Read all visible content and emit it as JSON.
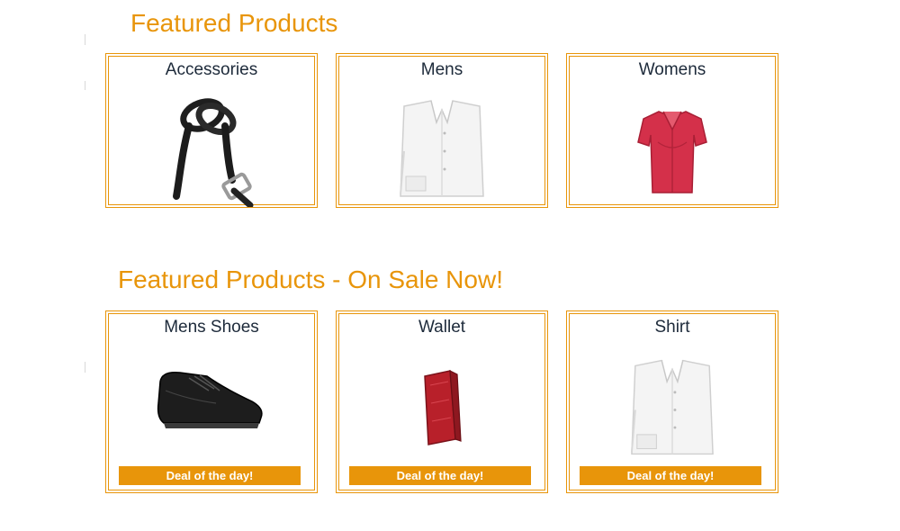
{
  "featured": {
    "title": "Featured Products",
    "items": [
      {
        "name": "Accessories",
        "icon": "belt-icon"
      },
      {
        "name": "Mens",
        "icon": "white-shirt-icon"
      },
      {
        "name": "Womens",
        "icon": "red-blouse-icon"
      }
    ]
  },
  "sale": {
    "title": "Featured Products - On Sale Now!",
    "items": [
      {
        "name": "Mens Shoes",
        "icon": "shoe-icon",
        "badge": "Deal of the day!"
      },
      {
        "name": "Wallet",
        "icon": "wallet-icon",
        "badge": "Deal of the day!"
      },
      {
        "name": "Shirt",
        "icon": "white-shirt-icon",
        "badge": "Deal of the day!"
      }
    ]
  },
  "colors": {
    "accent": "#e8950a",
    "heading_text": "#1d2a3a",
    "badge_text": "#ffffff"
  }
}
